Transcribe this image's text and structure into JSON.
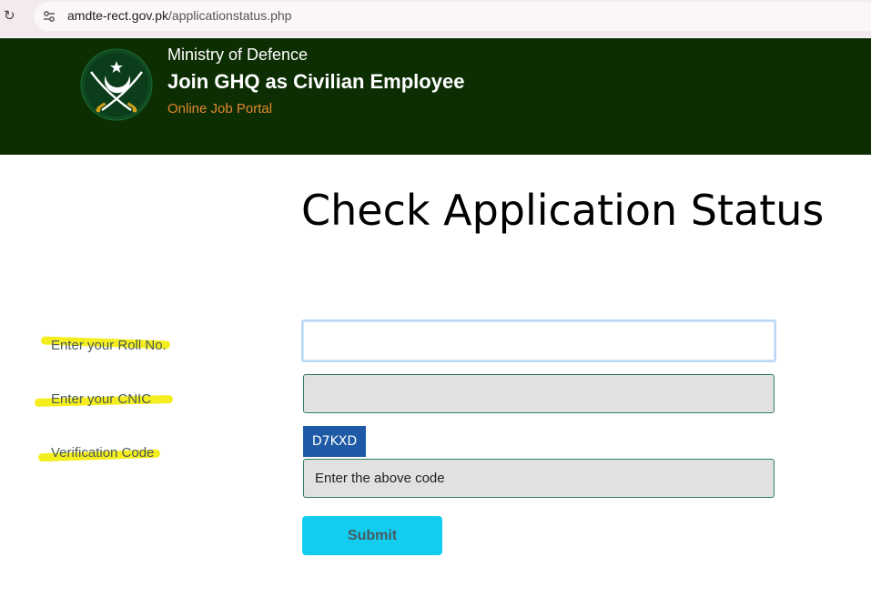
{
  "browser": {
    "url_host": "amdte-rect.gov.pk",
    "url_path": "/applicationstatus.php"
  },
  "header": {
    "ministry": "Ministry of Defence",
    "title": "Join GHQ as Civilian Employee",
    "subtitle": "Online Job Portal"
  },
  "main": {
    "page_title": "Check Application Status"
  },
  "form": {
    "roll_label": "Enter your Roll No.",
    "cnic_label": "Enter your CNIC",
    "verification_label": "Verification Code",
    "roll_value": "",
    "cnic_value": "",
    "captcha_text": "D7KXD",
    "code_placeholder": "Enter the above code",
    "submit_label": "Submit"
  },
  "colors": {
    "header_bg": "#0d2e03",
    "subtitle": "#e08830",
    "highlight": "#f5ee1e",
    "captcha_bg": "#1f5aa6",
    "submit_bg": "#12cdf0"
  }
}
